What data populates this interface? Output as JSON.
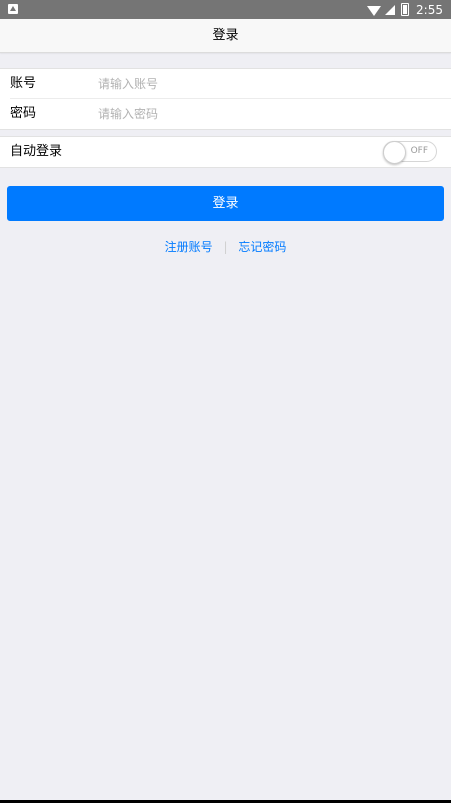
{
  "status_bar": {
    "time": "2:55",
    "icons": [
      "notification-icon",
      "wifi-icon",
      "signal-icon",
      "battery-icon"
    ]
  },
  "nav": {
    "title": "登录"
  },
  "form": {
    "account_label": "账号",
    "account_placeholder": "请输入账号",
    "account_value": "",
    "password_label": "密码",
    "password_placeholder": "请输入密码",
    "password_value": ""
  },
  "auto_login": {
    "label": "自动登录",
    "toggle_state": "OFF"
  },
  "login_button": {
    "label": "登录"
  },
  "links": {
    "register": "注册账号",
    "separator": "|",
    "forgot_password": "忘记密码"
  },
  "colors": {
    "accent": "#007aff",
    "background": "#efeff4",
    "status_bar": "#757575"
  }
}
